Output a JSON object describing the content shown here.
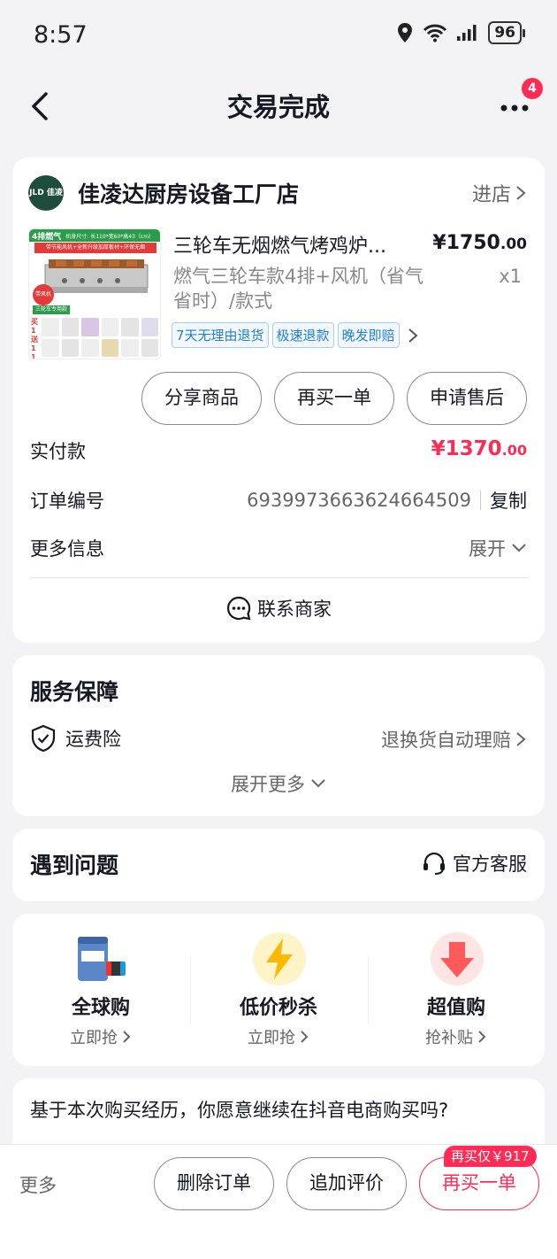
{
  "status": {
    "time": "8:57",
    "battery": "96"
  },
  "nav": {
    "title": "交易完成",
    "badge": "4"
  },
  "shop": {
    "logo_text": "JLD 佳凌达",
    "name": "佳凌达厨房设备工厂店",
    "enter": "进店"
  },
  "product": {
    "title": "三轮车无烟燃气烤鸡炉...",
    "price_main": "¥1750",
    "price_dec": ".00",
    "spec": "燃气三轮车款4排+风机（省气省时）/款式",
    "qty": "x1",
    "img_top_label": "4排燃气",
    "img_dims": "机身尺寸: 长110*宽60*高43（cm）",
    "img_sub": "带节能风机+全新升级加厚板材+环保无烟",
    "img_tag": "三轮车专用款",
    "img_fan": "带风机",
    "img_side": "买1送11",
    "tags": [
      "7天无理由退货",
      "极速退款",
      "晚发即赔"
    ]
  },
  "actions": {
    "share": "分享商品",
    "rebuy": "再买一单",
    "aftersale": "申请售后"
  },
  "order": {
    "paid_label": "实付款",
    "paid_main": "¥1370",
    "paid_dec": ".00",
    "id_label": "订单编号",
    "id_value": "6939973663624664509",
    "copy": "复制",
    "more_label": "更多信息",
    "expand": "展开",
    "contact": "联系商家"
  },
  "service": {
    "title": "服务保障",
    "item_label": "运费险",
    "item_desc": "退换货自动理赔",
    "expand_more": "展开更多"
  },
  "problem": {
    "title": "遇到问题",
    "cs": "官方客服"
  },
  "promos": [
    {
      "title": "全球购",
      "sub": "立即抢",
      "icon": "milk-powder-icon"
    },
    {
      "title": "低价秒杀",
      "sub": "立即抢",
      "icon": "lightning-icon"
    },
    {
      "title": "超值购",
      "sub": "抢补贴",
      "icon": "down-arrow-icon"
    }
  ],
  "survey": {
    "question": "基于本次购买经历，你愿意继续在抖音电商购买吗?"
  },
  "bottom": {
    "more": "更多",
    "delete": "删除订单",
    "review": "追加评价",
    "rebuy": "再买一单",
    "rebuy_badge": "再买仅￥917"
  },
  "colors": {
    "accent": "#fe2c55",
    "tag_blue": "#1e7fd6",
    "background": "#f3f3f5"
  }
}
